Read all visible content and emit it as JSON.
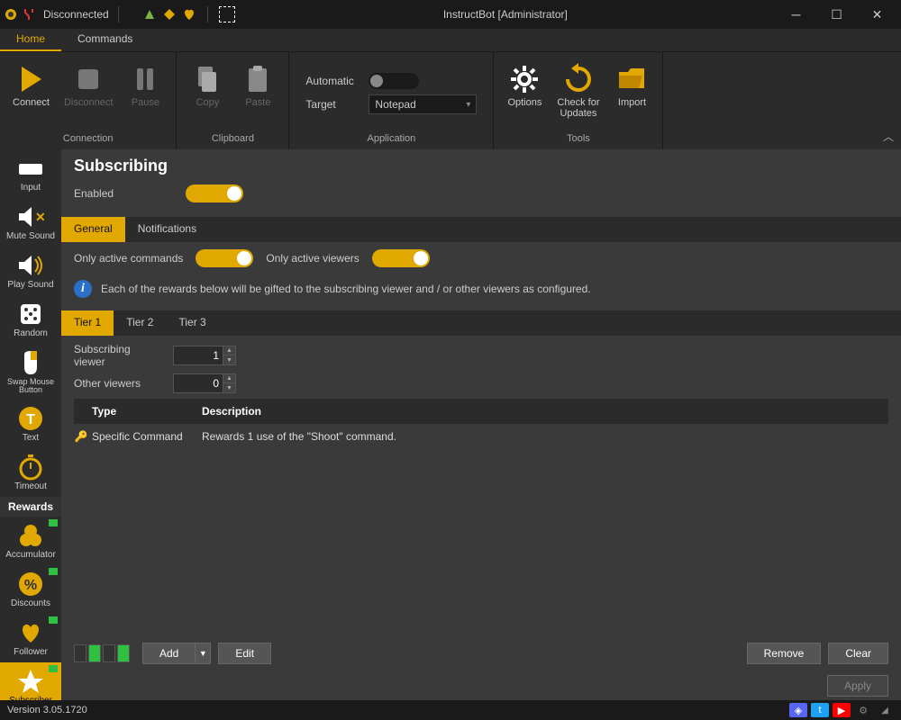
{
  "titlebar": {
    "status": "Disconnected",
    "title": "InstructBot [Administrator]"
  },
  "menu": {
    "home": "Home",
    "commands": "Commands"
  },
  "ribbon": {
    "connect": "Connect",
    "disconnect": "Disconnect",
    "pause": "Pause",
    "copy": "Copy",
    "paste": "Paste",
    "automatic": "Automatic",
    "target": "Target",
    "target_value": "Notepad",
    "options": "Options",
    "check_updates": "Check for\nUpdates",
    "import": "Import",
    "groups": {
      "connection": "Connection",
      "clipboard": "Clipboard",
      "application": "Application",
      "tools": "Tools"
    }
  },
  "sidebar": {
    "rewards_header": "Rewards",
    "items": [
      {
        "label": "Input"
      },
      {
        "label": "Mute Sound"
      },
      {
        "label": "Play Sound"
      },
      {
        "label": "Random"
      },
      {
        "label": "Swap Mouse\nButton"
      },
      {
        "label": "Text"
      },
      {
        "label": "Timeout"
      }
    ],
    "rewards": [
      {
        "label": "Accumulator"
      },
      {
        "label": "Discounts"
      },
      {
        "label": "Follower"
      },
      {
        "label": "Subscriber"
      }
    ]
  },
  "main": {
    "title": "Subscribing",
    "enabled_label": "Enabled",
    "tabs": {
      "general": "General",
      "notifications": "Notifications"
    },
    "only_active_commands": "Only active commands",
    "only_active_viewers": "Only active viewers",
    "info_text": "Each of the rewards below will be gifted to the subscribing viewer and / or other viewers as configured.",
    "tier_tabs": [
      "Tier 1",
      "Tier 2",
      "Tier 3"
    ],
    "subscribing_viewer_label": "Subscribing viewer",
    "subscribing_viewer_value": "1",
    "other_viewers_label": "Other viewers",
    "other_viewers_value": "0",
    "table": {
      "headers": {
        "type": "Type",
        "description": "Description"
      },
      "rows": [
        {
          "type": "Specific Command",
          "description": "Rewards 1 use of the \"Shoot\" command."
        }
      ]
    },
    "buttons": {
      "add": "Add",
      "edit": "Edit",
      "remove": "Remove",
      "clear": "Clear",
      "apply": "Apply"
    }
  },
  "statusbar": {
    "version": "Version 3.05.1720"
  },
  "colors": {
    "accent": "#e0a800"
  }
}
